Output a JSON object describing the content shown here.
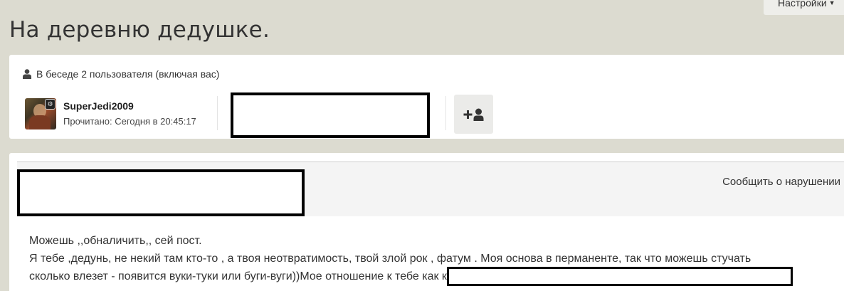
{
  "header": {
    "settings_label": "Настройки"
  },
  "page": {
    "title": "На деревню дедушке."
  },
  "conversation": {
    "participants_label": "В беседе 2 пользователя (включая вас)",
    "participant": {
      "name": "SuperJedi2009",
      "read_status": "Прочитано: Сегодня в 20:45:17"
    }
  },
  "message": {
    "report_label": "Сообщить о нарушении",
    "line1": "Можешь ,,обналичить,, сей пост.",
    "line2": "Я тебе ,дедунь, не некий там кто-то , а твоя неотвратимость, твой злой рок , фатум . Моя основа в перманенте, так что можешь стучать",
    "line3": "сколько влезет - появится вуки-туки или буги-вуги))Мое отношение к тебе как к"
  },
  "icons": [
    "caret-down-icon",
    "user-icon",
    "rank-badge-icon",
    "add-user-icon"
  ]
}
